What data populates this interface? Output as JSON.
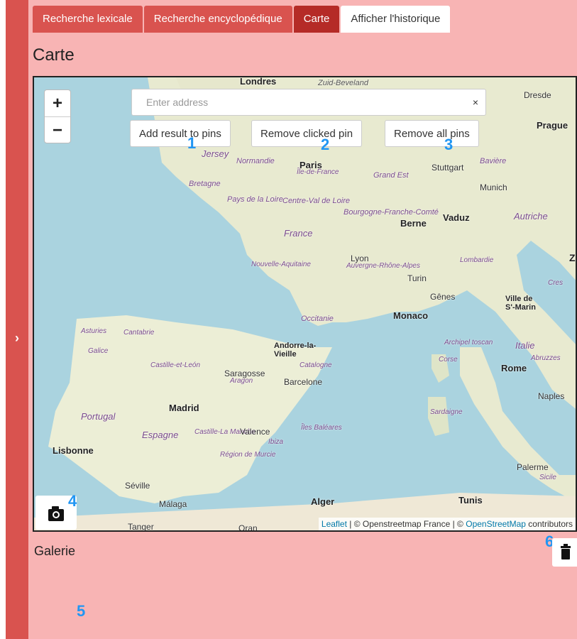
{
  "tabs": [
    {
      "label": "Recherche lexicale"
    },
    {
      "label": "Recherche encyclopédique"
    },
    {
      "label": "Carte"
    },
    {
      "label": "Afficher l'historique"
    }
  ],
  "section_title": "Carte",
  "map": {
    "zoom_in": "+",
    "zoom_out": "−",
    "address_placeholder": "Enter address",
    "address_clear": "×",
    "buttons": {
      "add": "Add result to pins",
      "remove_clicked": "Remove clicked pin",
      "remove_all": "Remove all pins"
    },
    "places": [
      "Londres",
      "Zuid-Beveland",
      "Dresde",
      "Prague",
      "Jersey",
      "Normandie",
      "Paris",
      "Île-de-France",
      "Grand Est",
      "Stuttgart",
      "Bavière",
      "Bretagne",
      "Pays de la Loire",
      "Centre-Val de Loire",
      "Bourgogne-Franche-Comté",
      "Munich",
      "Vaduz",
      "Berne",
      "Autriche",
      "France",
      "Lyon",
      "Auvergne-Rhône-Alpes",
      "Nouvelle-Aquitaine",
      "Turin",
      "Gênes",
      "Lombardie",
      "Monaco",
      "Occitanie",
      "Ville de S'-Marin",
      "Andorre-la-Vieille",
      "Catalogne",
      "Saragosse",
      "Aragon",
      "Barcelone",
      "Corse",
      "Archipel toscan",
      "Italie",
      "Rome",
      "Madrid",
      "Castille-et-León",
      "Portugal",
      "Espagne",
      "Castille-La Manche",
      "Valence",
      "Îles Baléares",
      "Ibiza",
      "Sardaigne",
      "Naples",
      "Lisbonne",
      "Région de Murcie",
      "Séville",
      "Málaga",
      "Alger",
      "Tunis",
      "Palerme",
      "Sicile",
      "Tanger",
      "Oran",
      "Asturies",
      "Cantabrie",
      "Galice",
      "Z",
      "Cres",
      "Abruzzes"
    ],
    "attribution": {
      "leaflet": "Leaflet",
      "sep1": " | © Openstreetmap France | © ",
      "osm": "OpenStreetMap",
      "contrib": " contributors"
    }
  },
  "gallery_title": "Galerie",
  "markers": [
    "1",
    "2",
    "3",
    "4",
    "5",
    "6"
  ],
  "colors": {
    "accent": "#d9534f",
    "accent_dark": "#b52b27",
    "page_bg": "#f8b4b4",
    "marker": "#2196f3"
  },
  "icons": {
    "sidebar_toggle": "chevron-right-icon",
    "camera": "camera-icon",
    "trash": "trash-icon"
  }
}
